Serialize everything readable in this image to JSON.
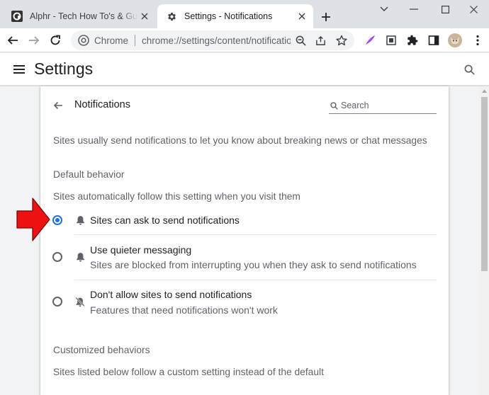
{
  "browser": {
    "tabs": [
      {
        "title": "Alphr - Tech How To's & Guides",
        "favicon": "alphr-logo-icon",
        "active": false
      },
      {
        "title": "Settings - Notifications",
        "favicon": "gear-icon",
        "active": true
      }
    ],
    "omnibox": {
      "site_name": "Chrome",
      "url": "chrome://settings/content/notifications"
    }
  },
  "settings": {
    "title": "Settings"
  },
  "page": {
    "subtitle": "Notifications",
    "search_placeholder": "Search",
    "intro": "Sites usually send notifications to let you know about breaking news or chat messages",
    "default_behavior": {
      "heading": "Default behavior",
      "description": "Sites automatically follow this setting when you visit them",
      "options": [
        {
          "label": "Sites can ask to send notifications",
          "sublabel": "",
          "icon": "bell-icon",
          "selected": true
        },
        {
          "label": "Use quieter messaging",
          "sublabel": "Sites are blocked from interrupting you when they ask to send notifications",
          "icon": "bell-icon",
          "selected": false
        },
        {
          "label": "Don't allow sites to send notifications",
          "sublabel": "Features that need notifications won't work",
          "icon": "bell-off-icon",
          "selected": false
        }
      ]
    },
    "customized_behaviors": {
      "heading": "Customized behaviors",
      "description": "Sites listed below follow a custom setting instead of the default"
    }
  },
  "colors": {
    "accent": "#1a73e8",
    "annotation_arrow": "#ee1111"
  }
}
